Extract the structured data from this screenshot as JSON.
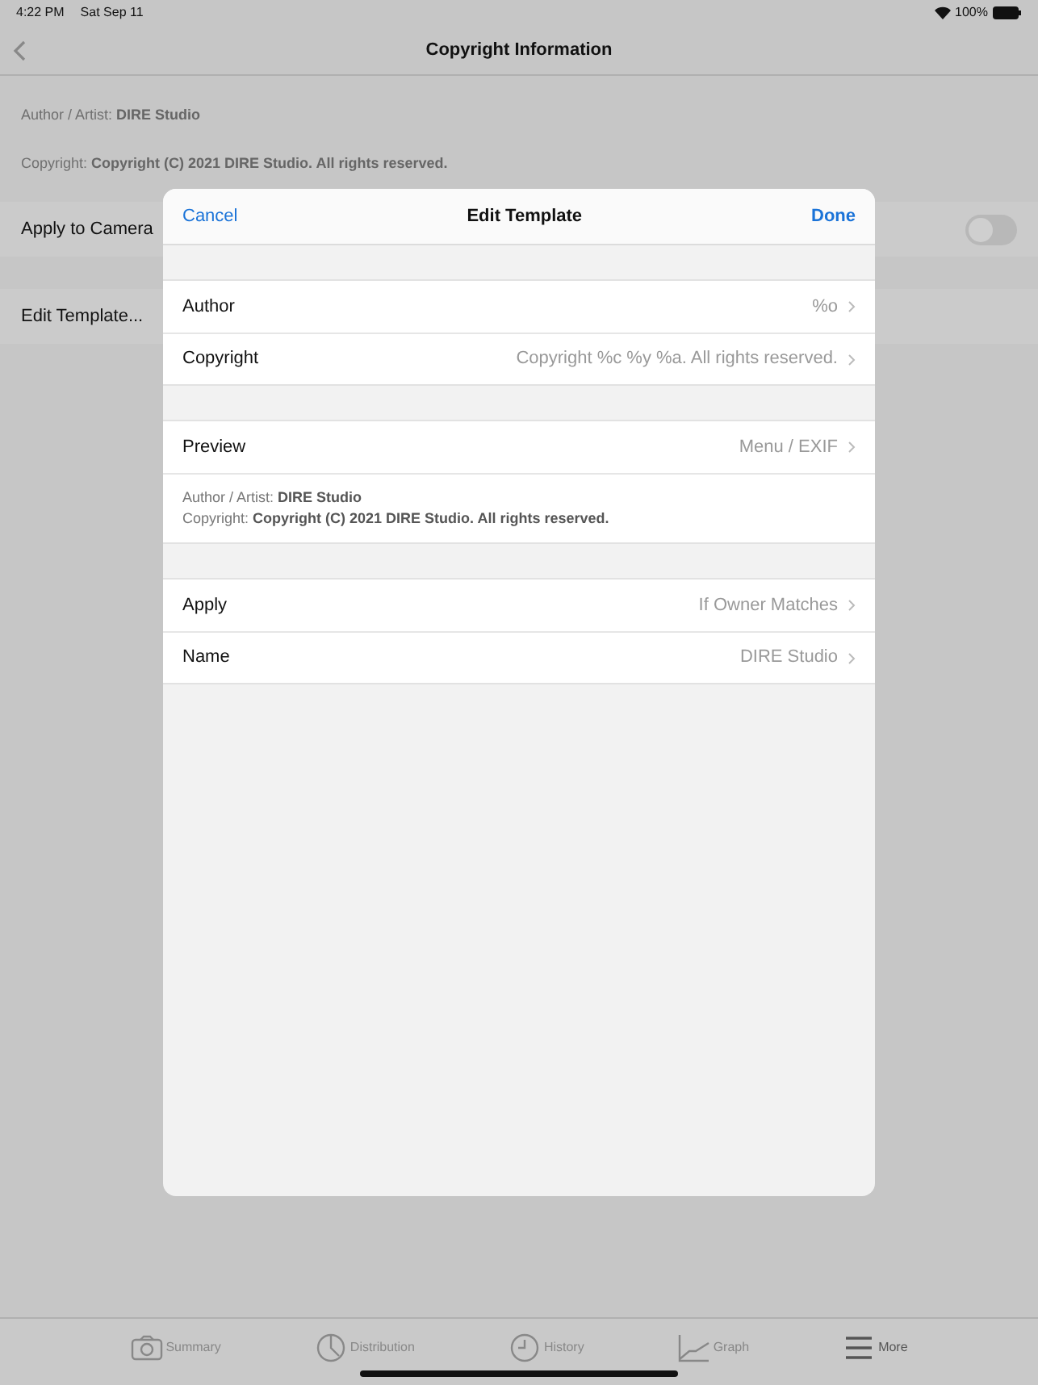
{
  "status_bar": {
    "time": "4:22 PM",
    "date": "Sat Sep 11",
    "battery": "100%"
  },
  "nav": {
    "title": "Copyright Information"
  },
  "info": [
    "Author / Artist: **DIRE Studio**",
    "Copyright: **Copyright (C) 2021 DIRE Studio. All rights reserved.**"
  ],
  "rows": [
    {
      "kind": "toggle",
      "label": "Apply to Camera",
      "on": false
    },
    {
      "kind": "link",
      "label": "Edit Template..."
    }
  ],
  "modal": {
    "cancel": "Cancel",
    "title": "Edit Template",
    "done": "Done",
    "sections": [
      [
        {
          "kind": "row",
          "label": "Author",
          "value": "%o"
        },
        {
          "kind": "row",
          "label": "Copyright",
          "value": "Copyright %c %y %a. All rights reserved."
        }
      ],
      [
        {
          "kind": "row",
          "label": "Preview",
          "value": "Menu / EXIF"
        },
        {
          "kind": "preview",
          "lines": [
            "Author / Artist: **DIRE Studio**",
            "Copyright: **Copyright (C) 2021 DIRE Studio. All rights reserved.**"
          ]
        }
      ],
      [
        {
          "kind": "row",
          "label": "Apply",
          "value": "If Owner Matches"
        },
        {
          "kind": "row",
          "label": "Name",
          "value": "DIRE Studio"
        }
      ]
    ]
  },
  "tabs": [
    {
      "kind": "camera",
      "label": "Summary",
      "selected": false
    },
    {
      "kind": "pie",
      "label": "Distribution",
      "selected": false
    },
    {
      "kind": "clock",
      "label": "History",
      "selected": false
    },
    {
      "kind": "graph",
      "label": "Graph",
      "selected": false
    },
    {
      "kind": "menu",
      "label": "More",
      "selected": true
    }
  ]
}
